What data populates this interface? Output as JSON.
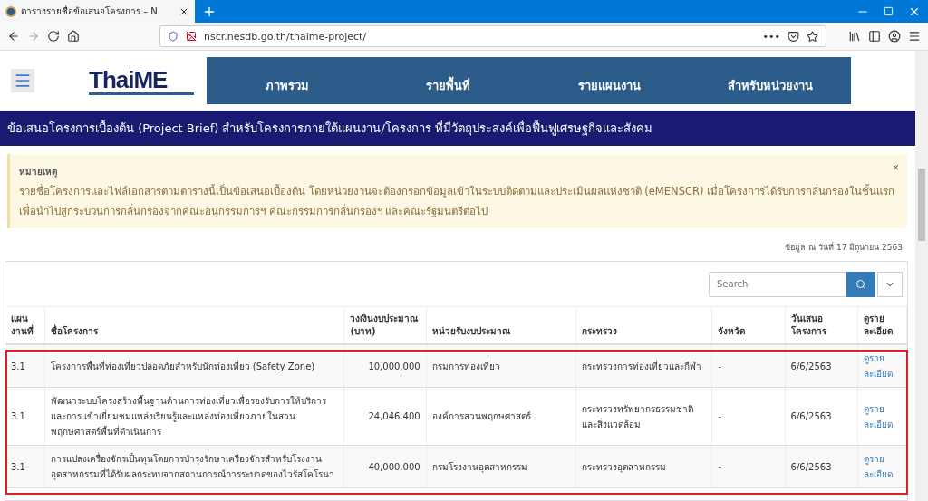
{
  "browser": {
    "tab_title": "ตารางรายชื่อข้อเสนอโครงการ – N",
    "url": "nscr.nesdb.go.th/thaime-project/",
    "url_menu": "•••"
  },
  "header": {
    "logo": "ThaiME",
    "nav": [
      {
        "label": "ภาพรวม"
      },
      {
        "label": "รายพื้นที่"
      },
      {
        "label": "รายแผนงาน"
      },
      {
        "label": "สำหรับหน่วยงาน"
      }
    ]
  },
  "banner": "ข้อเสนอโครงการเบื้องต้น (Project Brief) สำหรับโครงการภายใต้แผนงาน/โครงการ ที่มีวัตถุประสงค์เพื่อฟื้นฟูเศรษฐกิจและสังคม",
  "note": {
    "title": "หมายเหตุ",
    "lines": [
      "รายชื่อโครงการและไฟล์เอกสารตามตารางนี้เป็นข้อเสนอเบื้องต้น โดยหน่วยงานจะต้องกรอกข้อมูลเข้าในระบบติดตามและประเมินผลแห่งชาติ (eMENSCR) เมื่อโครงการได้รับการกลั่นกรองในชั้นแรก",
      "เพื่อนำไปสู่กระบวนการกลั่นกรองจากคณะอนุกรรมการฯ คณะกรรมการกลั่นกรองฯ และคณะรัฐมนตรีต่อไป"
    ],
    "close": "×"
  },
  "date_line": "ข้อมูล ณ วันที่ 17 มิถุนายน 2563",
  "table": {
    "search": {
      "placeholder": "Search"
    },
    "highlighted": true,
    "columns": [
      "แผนงานที่",
      "ชื่อโครงการ",
      "วงเงินงบประมาณ (บาท)",
      "หน่วยรับงบประมาณ",
      "กระทรวง",
      "จังหวัด",
      "วันเสนอโครงการ",
      "ดูรายละเอียด"
    ],
    "rows": [
      {
        "plan": "3.1",
        "name": "โครงการพื้นที่ท่องเที่ยวปลอดภัยสำหรับนักท่องเที่ยว (Safety Zone)",
        "budget": "10,000,000",
        "agency": "กรมการท่องเที่ยว",
        "ministry": "กระทรวงการท่องเที่ยวและกีฬา",
        "province": "-",
        "date": "6/6/2563",
        "link": "ดูรายละเอียด"
      },
      {
        "plan": "3.1",
        "name": "พัฒนาระบบโครงสร้างพื้นฐานด้านการท่องเที่ยวเพื่อรองรับการให้บริการและการ เข้าเยี่ยมชมแหล่งเรียนรู้และแหล่งท่องเที่ยวภายในสวนพฤกษศาสตร์พื้นที่ดำเนินการ",
        "budget": "24,046,400",
        "agency": "องค์การสวนพฤกษศาสตร์",
        "ministry": "กระทรวงทรัพยากรธรรมชาติและสิ่งแวดล้อม",
        "province": "-",
        "date": "6/6/2563",
        "link": "ดูรายละเอียด"
      },
      {
        "plan": "3.1",
        "name": "การแปลงเครื่องจักรเป็นทุนโดยการบำรุงรักษาเครื่องจักรสำหรับโรงงานอุตสาหกรรมที่ได้รับผลกระทบจากสถานการณ์การระบาดของไวรัสโคโรนา",
        "budget": "40,000,000",
        "agency": "กรมโรงงานอุตสาหกรรม",
        "ministry": "กระทรวงอุตสาหกรรม",
        "province": "-",
        "date": "6/6/2563",
        "link": "ดูรายละเอียด"
      }
    ]
  }
}
